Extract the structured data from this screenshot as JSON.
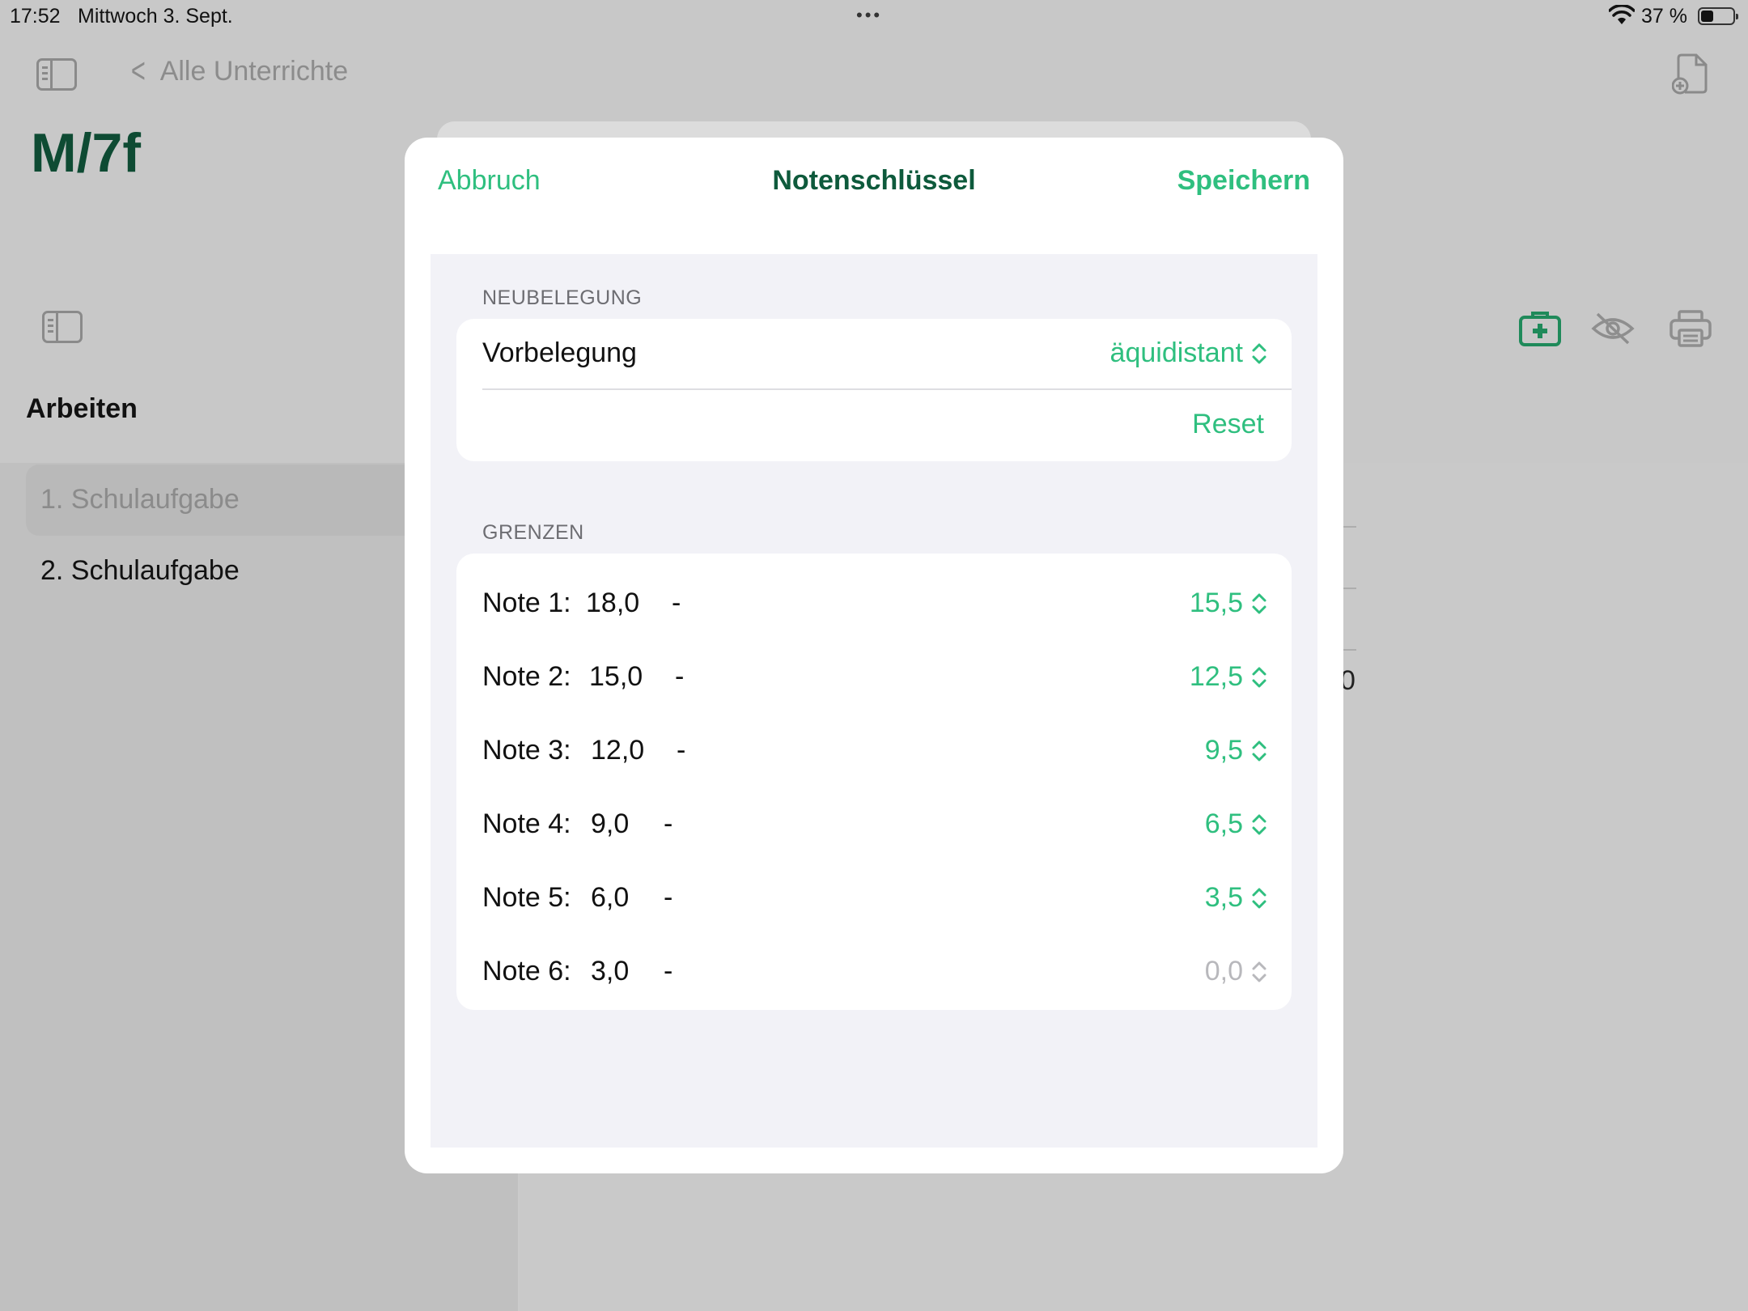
{
  "status_bar": {
    "time": "17:52",
    "date": "Mittwoch 3. Sept.",
    "battery_text": "37 %"
  },
  "nav": {
    "back_label": "Alle Unterrichte",
    "class_title": "M/7f"
  },
  "sidebar": {
    "heading": "Arbeiten",
    "items": [
      {
        "label": "1. Schulaufgabe",
        "selected": true
      },
      {
        "label": "2. Schulaufgabe",
        "selected": false
      }
    ]
  },
  "background": {
    "partial_value": "0"
  },
  "modal": {
    "cancel_label": "Abbruch",
    "title": "Notenschlüssel",
    "save_label": "Speichern",
    "section_reassign": {
      "header": "NEUBELEGUNG",
      "preset_label": "Vorbelegung",
      "preset_value": "äquidistant",
      "reset_label": "Reset"
    },
    "section_limits": {
      "header": "GRENZEN",
      "grades": [
        {
          "label": "Note 1:",
          "upper": "18,0",
          "dash": "-",
          "lower": "15,5",
          "enabled": true
        },
        {
          "label": "Note 2:",
          "upper": "15,0",
          "dash": "-",
          "lower": "12,5",
          "enabled": true
        },
        {
          "label": "Note 3:",
          "upper": "12,0",
          "dash": "-",
          "lower": "9,5",
          "enabled": true
        },
        {
          "label": "Note 4:",
          "upper": "9,0",
          "dash": "-",
          "lower": "6,5",
          "enabled": true
        },
        {
          "label": "Note 5:",
          "upper": "6,0",
          "dash": "-",
          "lower": "3,5",
          "enabled": true
        },
        {
          "label": "Note 6:",
          "upper": "3,0",
          "dash": "-",
          "lower": "0,0",
          "enabled": false
        }
      ]
    }
  },
  "colors": {
    "accent": "#2fbf7f",
    "title_dark_green": "#0e5a3c",
    "disabled": "#b8b8bc",
    "form_bg": "#f2f2f7"
  },
  "icons": [
    "sidebar-toggle-icon",
    "chevron-left-icon",
    "new-document-icon",
    "first-aid-kit-icon",
    "eye-slash-icon",
    "printer-icon",
    "updown-chevron-icon",
    "wifi-icon",
    "battery-icon"
  ]
}
